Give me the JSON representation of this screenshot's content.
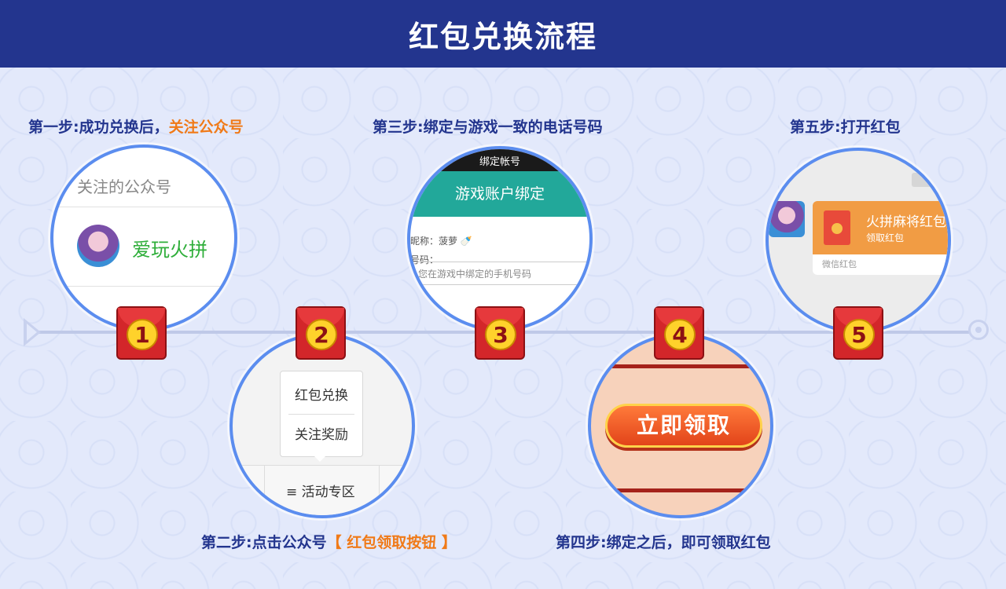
{
  "header": {
    "title": "红包兑换流程"
  },
  "steps": {
    "s1": {
      "prefix": "第一步:成功兑换后，",
      "highlight": "关注公众号"
    },
    "s2": {
      "prefix": "第二步:点击公众号",
      "highlight": "【 红包领取按钮 】"
    },
    "s3": {
      "prefix": "第三步:绑定与游戏一致的电话号码"
    },
    "s4": {
      "prefix": "第四步:绑定之后，即可领取红包"
    },
    "s5": {
      "prefix": "第五步:打开红包"
    }
  },
  "badges": [
    "1",
    "2",
    "3",
    "4",
    "5"
  ],
  "circle1": {
    "label": "关注的公众号",
    "account_name": "爱玩火拼"
  },
  "circle2": {
    "menu_item_1": "红包兑换",
    "menu_item_2": "关注奖励",
    "bar_item": "≡ 活动专区"
  },
  "circle3": {
    "topbar": "绑定帐号",
    "header": "游戏账户绑定",
    "nickname": "昵称：菠萝 🍼",
    "number": "号码：",
    "input_placeholder": "您在游戏中绑定的手机号码"
  },
  "circle4": {
    "button": "立即领取"
  },
  "circle5": {
    "title": "火拼麻将红包",
    "subtitle": "领取红包",
    "footer": "微信红包"
  },
  "colors": {
    "header_bg": "#23358e",
    "highlight": "#f07a18",
    "circle_border": "#5b8def",
    "badge_red": "#d3262a"
  }
}
